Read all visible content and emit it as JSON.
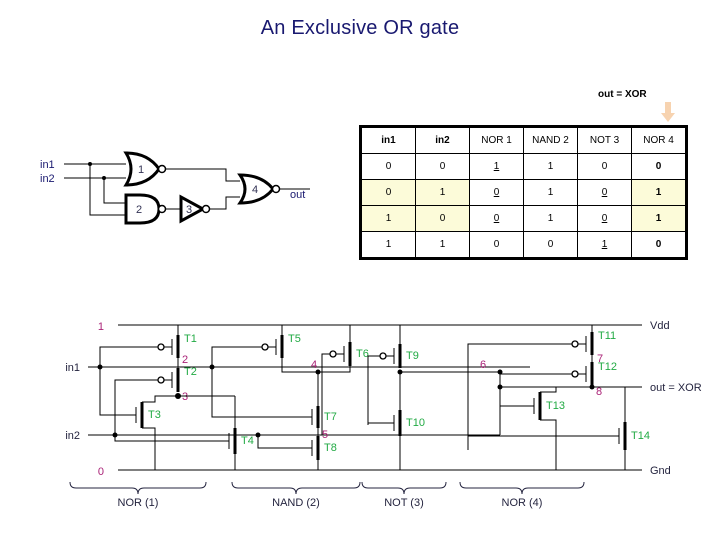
{
  "slide": {
    "title": "An Exclusive OR gate",
    "background": "#ffffff",
    "title_color": "#191970"
  },
  "xor_callout": {
    "caption": "out = XOR",
    "arrow_icon": "down-arrow-icon",
    "arrow_color": "#f7d3b0"
  },
  "truth_table": {
    "headers": [
      "in1",
      "in2",
      "NOR 1",
      "NAND 2",
      "NOT 3",
      "NOR 4"
    ],
    "highlight_color": "#fcfbd9",
    "rows": [
      {
        "highlighted": false,
        "cells": [
          {
            "value": "0",
            "underline": false,
            "bold": false,
            "highlight": false
          },
          {
            "value": "0",
            "underline": false,
            "bold": false,
            "highlight": false
          },
          {
            "value": "1",
            "underline": true,
            "bold": false,
            "highlight": false
          },
          {
            "value": "1",
            "underline": false,
            "bold": false,
            "highlight": false
          },
          {
            "value": "0",
            "underline": false,
            "bold": false,
            "highlight": false
          },
          {
            "value": "0",
            "underline": false,
            "bold": true,
            "highlight": false
          }
        ]
      },
      {
        "highlighted": true,
        "cells": [
          {
            "value": "0",
            "underline": false,
            "bold": false,
            "highlight": true
          },
          {
            "value": "1",
            "underline": false,
            "bold": false,
            "highlight": true
          },
          {
            "value": "0",
            "underline": true,
            "bold": false,
            "highlight": false
          },
          {
            "value": "1",
            "underline": false,
            "bold": false,
            "highlight": false
          },
          {
            "value": "0",
            "underline": true,
            "bold": false,
            "highlight": false
          },
          {
            "value": "1",
            "underline": false,
            "bold": true,
            "highlight": true
          }
        ]
      },
      {
        "highlighted": true,
        "cells": [
          {
            "value": "1",
            "underline": false,
            "bold": false,
            "highlight": true
          },
          {
            "value": "0",
            "underline": false,
            "bold": false,
            "highlight": true
          },
          {
            "value": "0",
            "underline": true,
            "bold": false,
            "highlight": false
          },
          {
            "value": "1",
            "underline": false,
            "bold": false,
            "highlight": false
          },
          {
            "value": "0",
            "underline": true,
            "bold": false,
            "highlight": false
          },
          {
            "value": "1",
            "underline": false,
            "bold": true,
            "highlight": true
          }
        ]
      },
      {
        "highlighted": false,
        "cells": [
          {
            "value": "1",
            "underline": false,
            "bold": false,
            "highlight": false
          },
          {
            "value": "1",
            "underline": false,
            "bold": false,
            "highlight": false
          },
          {
            "value": "0",
            "underline": false,
            "bold": false,
            "highlight": false
          },
          {
            "value": "0",
            "underline": false,
            "bold": false,
            "highlight": false
          },
          {
            "value": "1",
            "underline": true,
            "bold": false,
            "highlight": false
          },
          {
            "value": "0",
            "underline": false,
            "bold": true,
            "highlight": false
          }
        ]
      }
    ]
  },
  "gate_diagram": {
    "inputs": [
      "in1",
      "in2"
    ],
    "output": "out",
    "gates": [
      {
        "number": "1",
        "type": "NOR"
      },
      {
        "number": "2",
        "type": "NAND"
      },
      {
        "number": "3",
        "type": "NOT"
      },
      {
        "number": "4",
        "type": "NOR"
      }
    ]
  },
  "circuit": {
    "rail_labels": {
      "top_left": "1",
      "bottom_left": "0",
      "vdd": "Vdd",
      "gnd": "Gnd",
      "out": "out = XOR"
    },
    "inputs": [
      "in1",
      "in2"
    ],
    "transistors": [
      "T1",
      "T2",
      "T3",
      "T4",
      "T5",
      "T6",
      "T7",
      "T8",
      "T9",
      "T10",
      "T11",
      "T12",
      "T13",
      "T14"
    ],
    "nodes": [
      "2",
      "3",
      "4",
      "5",
      "6",
      "7",
      "8"
    ],
    "blocks": [
      "NOR (1)",
      "NAND (2)",
      "NOT (3)",
      "NOR (4)"
    ],
    "colors": {
      "transistor_label": "#22aa44",
      "node_label": "#aa2277",
      "io_label": "#24243f"
    }
  }
}
